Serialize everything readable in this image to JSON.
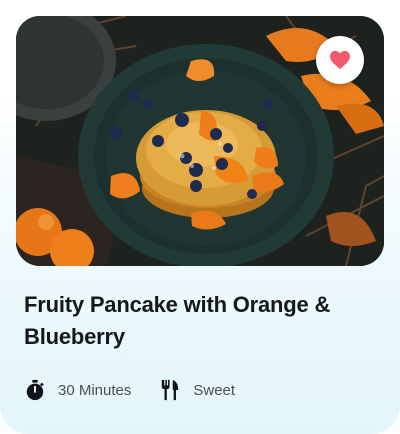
{
  "recipe": {
    "title": "Fruity Pancake with Orange & Blueberry",
    "image_icon": "pancake-photo",
    "favorite": {
      "icon": "heart-icon",
      "active": true,
      "color": "#f05a6a"
    },
    "duration": {
      "icon": "stopwatch-icon",
      "text": "30 Minutes"
    },
    "category": {
      "icon": "fork-knife-icon",
      "text": "Sweet"
    }
  }
}
